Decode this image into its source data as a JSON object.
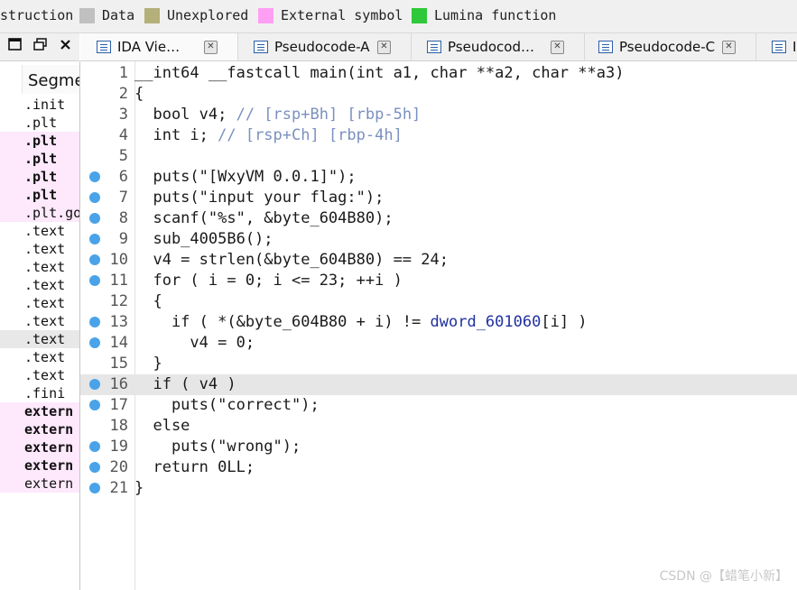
{
  "legend": [
    {
      "label": "struction",
      "color": null
    },
    {
      "label": "Data",
      "color": "#c0c0c0"
    },
    {
      "label": "Unexplored",
      "color": "#b5b07a"
    },
    {
      "label": "External symbol",
      "color": "#ff9ff3"
    },
    {
      "label": "Lumina function",
      "color": "#2ec83a"
    }
  ],
  "segments": {
    "header": "Segme",
    "rows": [
      {
        "name": ".init",
        "style": "normal"
      },
      {
        "name": ".plt",
        "style": "normal"
      },
      {
        "name": ".plt",
        "style": "pinkbold"
      },
      {
        "name": ".plt",
        "style": "pinkbold"
      },
      {
        "name": ".plt",
        "style": "pinkbold"
      },
      {
        "name": ".plt",
        "style": "pinkbold"
      },
      {
        "name": ".plt.got",
        "style": "pink"
      },
      {
        "name": ".text",
        "style": "normal"
      },
      {
        "name": ".text",
        "style": "normal"
      },
      {
        "name": ".text",
        "style": "normal"
      },
      {
        "name": ".text",
        "style": "normal"
      },
      {
        "name": ".text",
        "style": "normal"
      },
      {
        "name": ".text",
        "style": "normal"
      },
      {
        "name": ".text",
        "style": "selected"
      },
      {
        "name": ".text",
        "style": "normal"
      },
      {
        "name": ".text",
        "style": "normal"
      },
      {
        "name": ".fini",
        "style": "normal"
      },
      {
        "name": "extern",
        "style": "pinkbold"
      },
      {
        "name": "extern",
        "style": "pinkbold"
      },
      {
        "name": "extern",
        "style": "pinkbold"
      },
      {
        "name": "extern",
        "style": "pinkbold"
      },
      {
        "name": "extern",
        "style": "pink"
      }
    ]
  },
  "tabs": [
    {
      "label": "IDA Vie…",
      "active": true
    },
    {
      "label": "Pseudocode-A",
      "active": false
    },
    {
      "label": "Pseudocod…",
      "active": false
    },
    {
      "label": "Pseudocode-C",
      "active": false
    },
    {
      "label": "I",
      "active": false
    }
  ],
  "code": {
    "lines": [
      {
        "n": "1",
        "bp": false,
        "text": "__int64 __fastcall main(int a1, char **a2, char **a3)"
      },
      {
        "n": "2",
        "bp": false,
        "text": "{"
      },
      {
        "n": "3",
        "bp": false,
        "text": "  bool v4; // [rsp+Bh] [rbp-5h]"
      },
      {
        "n": "4",
        "bp": false,
        "text": "  int i; // [rsp+Ch] [rbp-4h]"
      },
      {
        "n": "5",
        "bp": false,
        "text": ""
      },
      {
        "n": "6",
        "bp": true,
        "text": "  puts(\"[WxyVM 0.0.1]\");"
      },
      {
        "n": "7",
        "bp": true,
        "text": "  puts(\"input your flag:\");"
      },
      {
        "n": "8",
        "bp": true,
        "text": "  scanf(\"%s\", &byte_604B80);"
      },
      {
        "n": "9",
        "bp": true,
        "text": "  sub_4005B6();"
      },
      {
        "n": "10",
        "bp": true,
        "text": "  v4 = strlen(&byte_604B80) == 24;"
      },
      {
        "n": "11",
        "bp": true,
        "text": "  for ( i = 0; i <= 23; ++i )"
      },
      {
        "n": "12",
        "bp": false,
        "text": "  {"
      },
      {
        "n": "13",
        "bp": true,
        "text": "    if ( *(&byte_604B80 + i) != dword_601060[i] )"
      },
      {
        "n": "14",
        "bp": true,
        "text": "      v4 = 0;"
      },
      {
        "n": "15",
        "bp": false,
        "text": "  }"
      },
      {
        "n": "16",
        "bp": true,
        "text": "  if ( v4 )"
      },
      {
        "n": "17",
        "bp": true,
        "text": "    puts(\"correct\");"
      },
      {
        "n": "18",
        "bp": false,
        "text": "  else"
      },
      {
        "n": "19",
        "bp": true,
        "text": "    puts(\"wrong\");"
      },
      {
        "n": "20",
        "bp": true,
        "text": "  return 0LL;"
      },
      {
        "n": "21",
        "bp": true,
        "text": "}"
      }
    ],
    "highlighted_line": "16"
  },
  "watermark": "CSDN @【蜡笔小新】",
  "icons": {
    "restore": "restore-window-icon",
    "float": "float-window-icon",
    "close": "close-icon",
    "tab": "pseudocode-tab-icon",
    "breakpoint": "breakpoint-dot-icon"
  },
  "colors": {
    "breakpoint": "#4aa3e8",
    "highlight": "#e6e6e6",
    "comment": "#7a90c0",
    "variable": "#5a6fd6"
  }
}
